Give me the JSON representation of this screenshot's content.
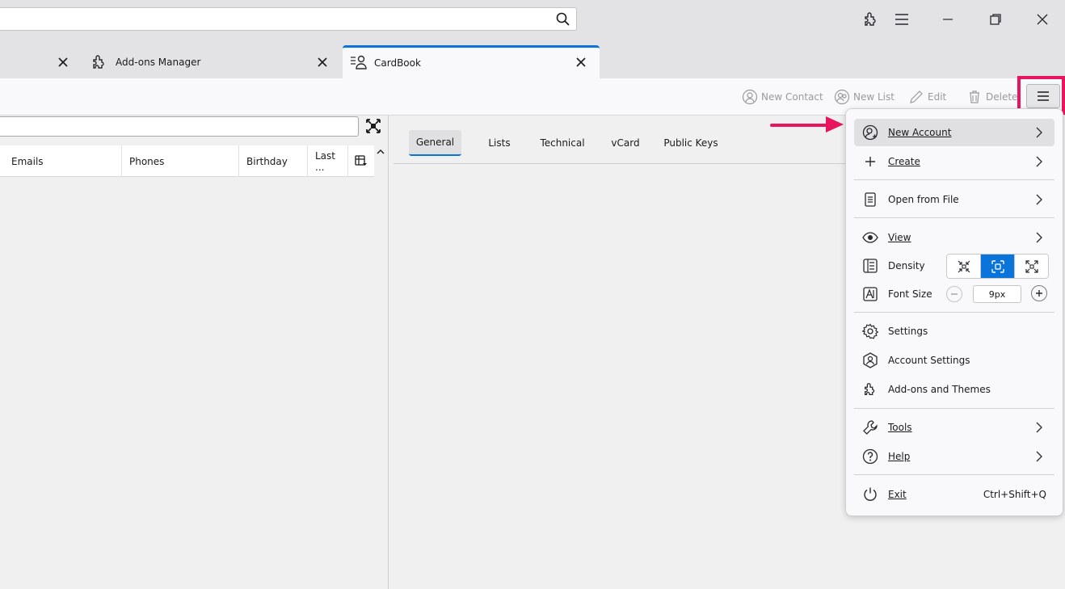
{
  "tabs": [
    {
      "label": "Add-ons Manager"
    },
    {
      "label": "CardBook"
    }
  ],
  "toolbar": {
    "new_contact": "New Contact",
    "new_list": "New List",
    "edit": "Edit",
    "delete": "Delete"
  },
  "table": {
    "columns": [
      "Emails",
      "Phones",
      "Birthday",
      "Last ..."
    ]
  },
  "panel_tabs": [
    "General",
    "Lists",
    "Technical",
    "vCard",
    "Public Keys"
  ],
  "menu": {
    "new_account": "New Account",
    "create": "Create",
    "open_from_file": "Open from File",
    "view": "View",
    "density": "Density",
    "font_size": "Font Size",
    "font_size_value": "9px",
    "settings": "Settings",
    "account_settings": "Account Settings",
    "addons_themes": "Add-ons and Themes",
    "tools": "Tools",
    "help": "Help",
    "exit": "Exit",
    "exit_shortcut": "Ctrl+Shift+Q"
  },
  "colors": {
    "accent": "#0a74da",
    "highlight": "#e8145e"
  }
}
